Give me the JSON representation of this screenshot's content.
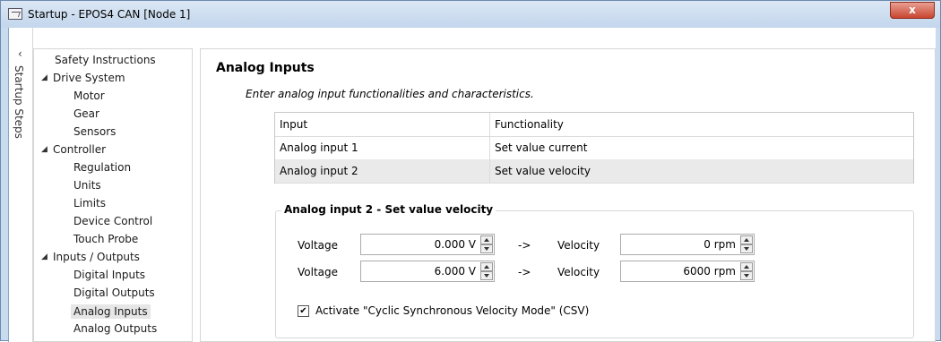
{
  "window": {
    "title": "Startup - EPOS4 CAN [Node 1]",
    "close_label": "x"
  },
  "side_strip": {
    "collapse_glyph": "‹",
    "label": "Startup Steps"
  },
  "tree": [
    {
      "label": "Safety Instructions",
      "level": 1,
      "arrow": ""
    },
    {
      "label": "Drive System",
      "level": 0,
      "arrow": "◢"
    },
    {
      "label": "Motor",
      "level": 2,
      "arrow": ""
    },
    {
      "label": "Gear",
      "level": 2,
      "arrow": ""
    },
    {
      "label": "Sensors",
      "level": 2,
      "arrow": ""
    },
    {
      "label": "Controller",
      "level": 0,
      "arrow": "◢"
    },
    {
      "label": "Regulation",
      "level": 2,
      "arrow": ""
    },
    {
      "label": "Units",
      "level": 2,
      "arrow": ""
    },
    {
      "label": "Limits",
      "level": 2,
      "arrow": ""
    },
    {
      "label": "Device Control",
      "level": 2,
      "arrow": ""
    },
    {
      "label": "Touch Probe",
      "level": 2,
      "arrow": ""
    },
    {
      "label": "Inputs / Outputs",
      "level": 0,
      "arrow": "◢"
    },
    {
      "label": "Digital Inputs",
      "level": 2,
      "arrow": ""
    },
    {
      "label": "Digital Outputs",
      "level": 2,
      "arrow": ""
    },
    {
      "label": "Analog Inputs",
      "level": 2,
      "arrow": "",
      "selected": true
    },
    {
      "label": "Analog Outputs",
      "level": 2,
      "arrow": ""
    }
  ],
  "main": {
    "title": "Analog Inputs",
    "description": "Enter analog input functionalities and characteristics.",
    "table": {
      "headers": [
        "Input",
        "Functionality"
      ],
      "rows": [
        [
          "Analog input 1",
          "Set value current"
        ],
        [
          "Analog input 2",
          "Set value velocity"
        ]
      ]
    },
    "group": {
      "title": "Analog input 2 - Set value velocity",
      "rows": [
        {
          "voltage_label": "Voltage",
          "voltage": "0.000 V",
          "arrow": "->",
          "velocity_label": "Velocity",
          "velocity": "0 rpm"
        },
        {
          "voltage_label": "Voltage",
          "voltage": "6.000 V",
          "arrow": "->",
          "velocity_label": "Velocity",
          "velocity": "6000 rpm"
        }
      ],
      "checkbox": {
        "checked": true,
        "mark": "✔",
        "label": "Activate \"Cyclic Synchronous Velocity Mode\" (CSV)"
      }
    }
  }
}
